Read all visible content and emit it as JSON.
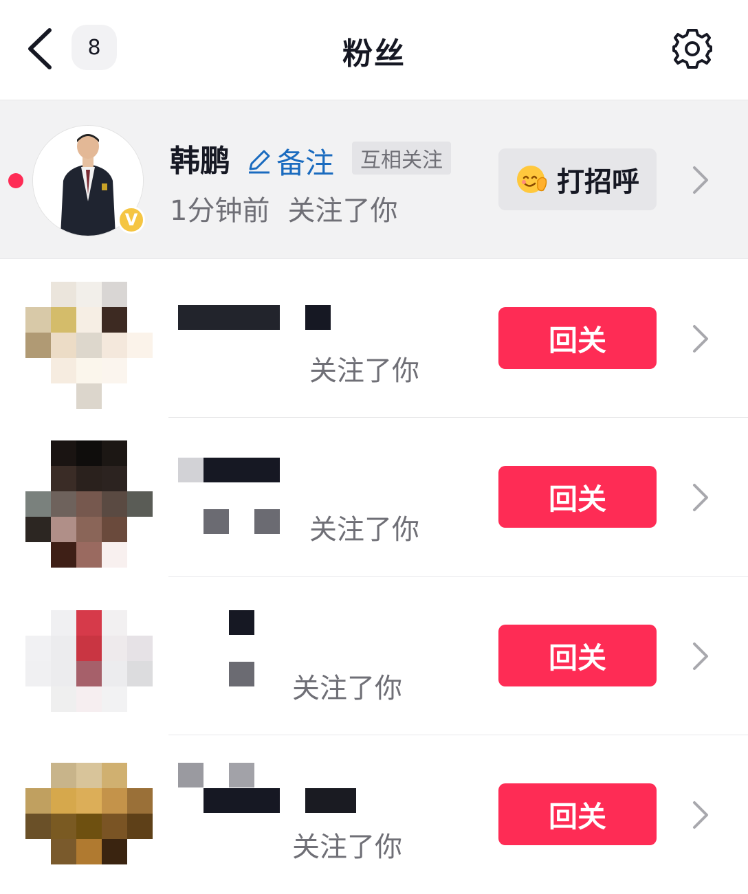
{
  "header": {
    "back_icon": "chevron-left-icon",
    "unread_count": "8",
    "title": "粉丝",
    "settings_icon": "gear-icon"
  },
  "colors": {
    "accent": "#fe2c55",
    "highlight_bg": "#f2f2f3",
    "remark_blue": "#1a6bbf",
    "secondary_text": "#6f6f76"
  },
  "fans": [
    {
      "name": "韩鹏",
      "remark_label": "备注",
      "relation_tag": "互相关注",
      "time": "1分钟前",
      "action_text": "关注了你",
      "button_label": "打招呼",
      "verified_badge": "V",
      "unread": true
    },
    {
      "name": "",
      "time": "",
      "action_text": "关注了你",
      "button_label": "回关"
    },
    {
      "name": "",
      "time": "",
      "action_text": "关注了你",
      "button_label": "回关"
    },
    {
      "name": "",
      "time": "",
      "action_text": "关注了你",
      "button_label": "回关"
    },
    {
      "name": "",
      "time": "",
      "action_text": "关注了你",
      "button_label": "回关"
    }
  ]
}
